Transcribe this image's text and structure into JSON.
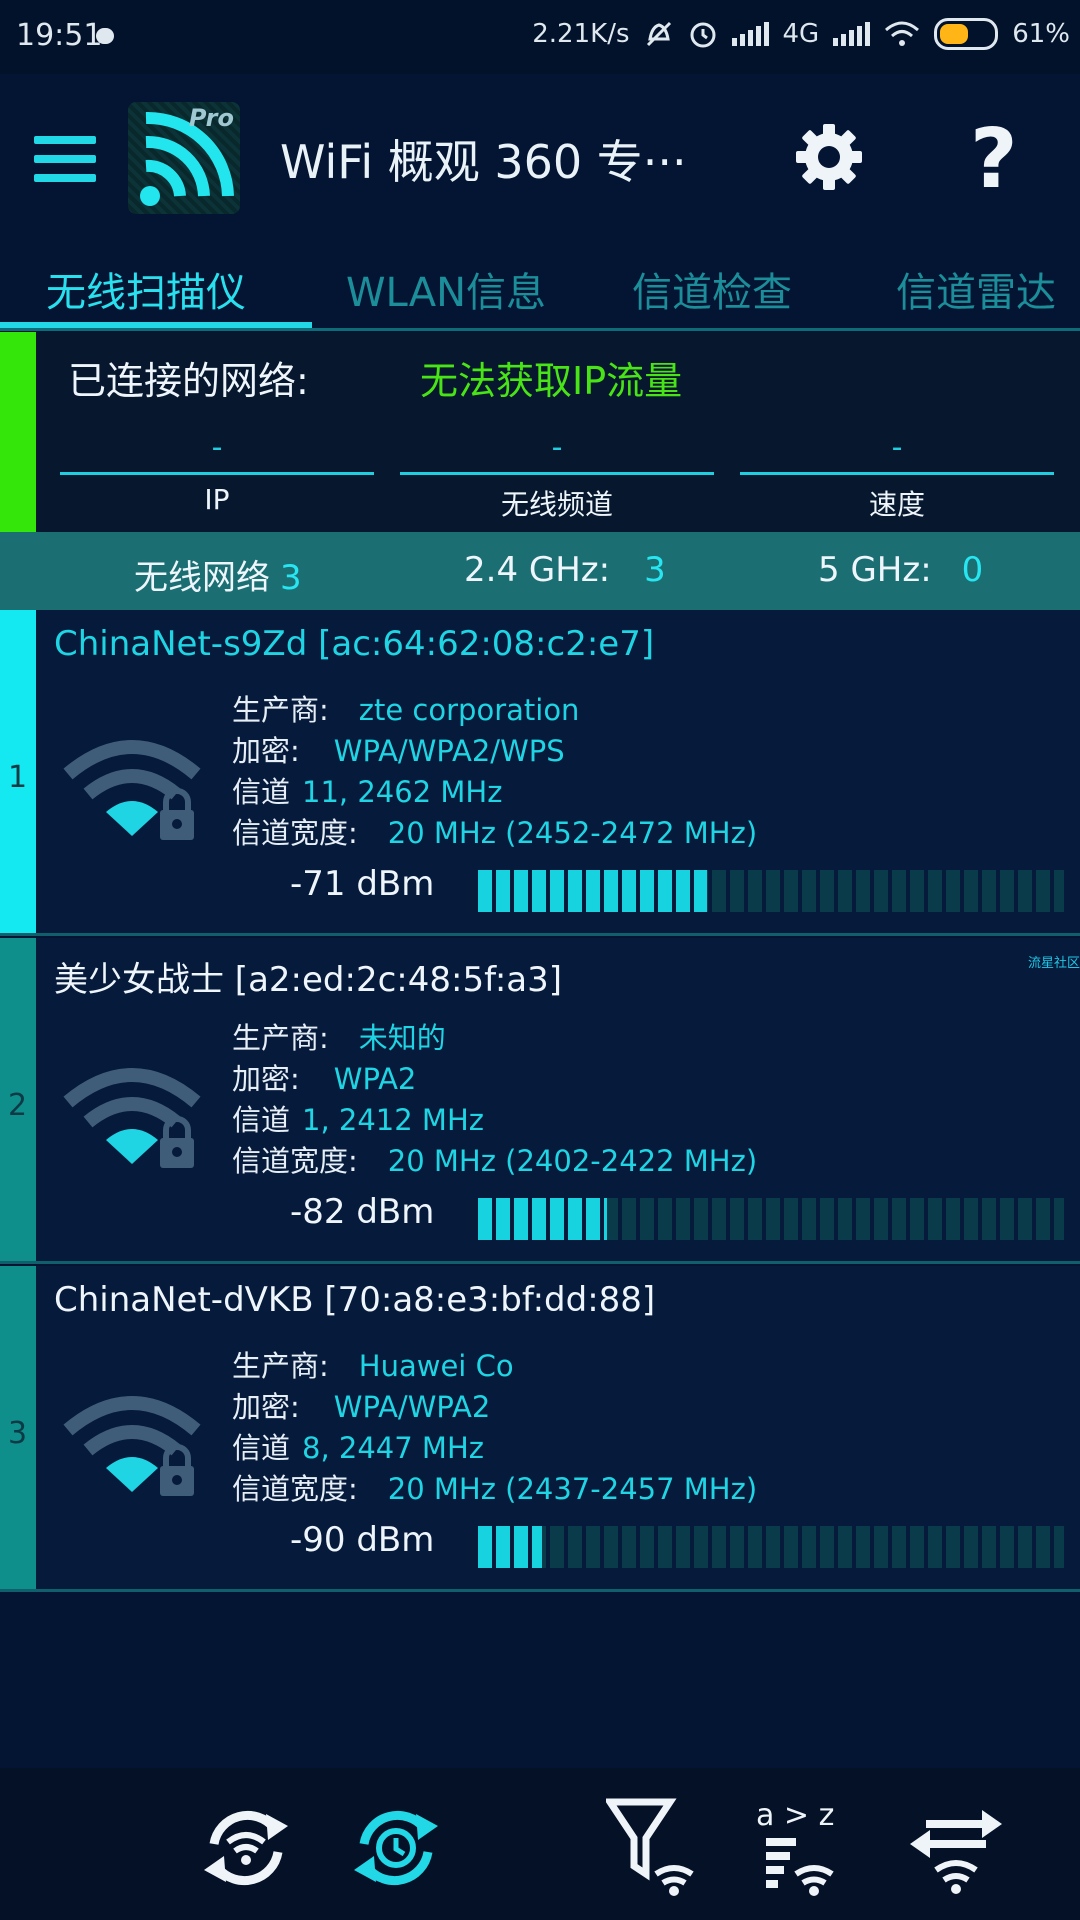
{
  "status_bar": {
    "time": "19:51",
    "speed": "2.21K/s",
    "network": "4G",
    "battery": "61%",
    "battery_level": 0.61
  },
  "app_bar": {
    "logo_badge": "Pro",
    "title": "WiFi 概观 360 专···",
    "help_label": "?"
  },
  "tabs": [
    {
      "label": "无线扫描仪"
    },
    {
      "label": "WLAN信息"
    },
    {
      "label": "信道检查"
    },
    {
      "label": "信道雷达"
    }
  ],
  "connected": {
    "label": "已连接的网络:",
    "status": "无法获取IP流量",
    "fields": [
      {
        "value": "-",
        "label": "IP"
      },
      {
        "value": "-",
        "label": "无线频道"
      },
      {
        "value": "-",
        "label": "速度"
      }
    ]
  },
  "summary": {
    "networks_label": "无线网络",
    "networks_count": "3",
    "band24_label": "2.4 GHz:",
    "band24_count": "3",
    "band5_label": "5 GHz:",
    "band5_count": "0"
  },
  "networks": [
    {
      "index": "1",
      "ssid": "ChinaNet-s9Zd [ac:64:62:08:c2:e7]",
      "vendor_label": "生产商:",
      "vendor": "zte corporation",
      "encryption_label": "加密:",
      "encryption": "WPA/WPA2/WPS",
      "channel_label": "信道",
      "channel": "11, 2462 MHz",
      "width_label": "信道宽度:",
      "width": "20 MHz (2452-2472 MHz)",
      "rssi": "-71 dBm",
      "signal_fraction": 0.39,
      "stripe_color": "#14e8f0",
      "ssid_color": "#1fd4e3"
    },
    {
      "index": "2",
      "ssid": "美少女战士 [a2:ed:2c:48:5f:a3]",
      "vendor_label": "生产商:",
      "vendor": "未知的",
      "encryption_label": "加密:",
      "encryption": "WPA2",
      "channel_label": "信道",
      "channel": "1, 2412 MHz",
      "width_label": "信道宽度:",
      "width": "20 MHz (2402-2422 MHz)",
      "rssi": "-82 dBm",
      "signal_fraction": 0.22,
      "stripe_color": "#0f8f8c",
      "ssid_color": "#eef5fb"
    },
    {
      "index": "3",
      "ssid": "ChinaNet-dVKB [70:a8:e3:bf:dd:88]",
      "vendor_label": "生产商:",
      "vendor": "Huawei Co",
      "encryption_label": "加密:",
      "encryption": "WPA/WPA2",
      "channel_label": "信道",
      "channel": "8, 2447 MHz",
      "width_label": "信道宽度:",
      "width": "20 MHz (2437-2457 MHz)",
      "rssi": "-90 dBm",
      "signal_fraction": 0.11,
      "stripe_color": "#0f8f8c",
      "ssid_color": "#eef5fb"
    }
  ],
  "watermark": "流星社区",
  "bottom_icons": [
    {
      "name": "wifi-refresh-icon"
    },
    {
      "name": "timer-refresh-icon"
    },
    {
      "name": "filter-icon"
    },
    {
      "name": "sort-icon",
      "text": "a > z"
    },
    {
      "name": "swap-icon"
    }
  ]
}
